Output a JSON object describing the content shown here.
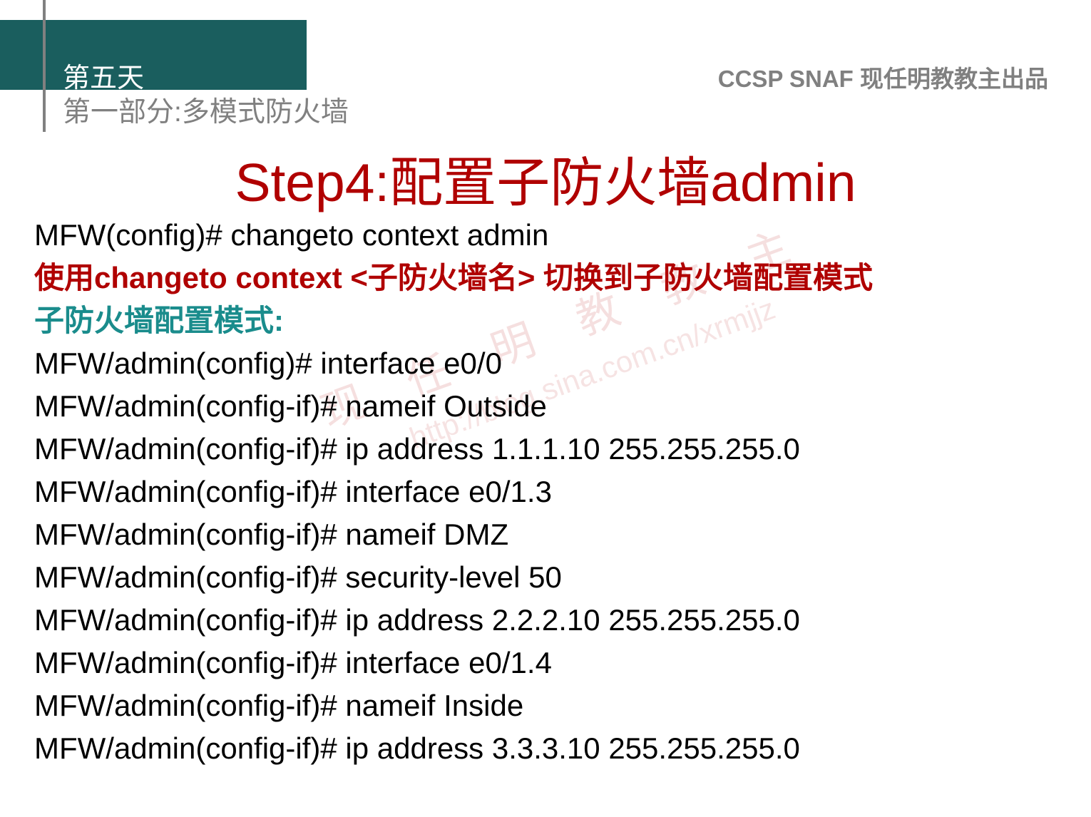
{
  "header": {
    "day": "第五天",
    "section": "第一部分:多模式防火墙",
    "source": "CCSP SNAF  现任明教教主出品"
  },
  "title": "Step4:配置子防火墙admin",
  "lines": [
    {
      "cls": "",
      "text": "MFW(config)# changeto context admin"
    },
    {
      "cls": "red",
      "text": "使用changeto context <子防火墙名> 切换到子防火墙配置模式"
    },
    {
      "cls": "teal",
      "text": "子防火墙配置模式:"
    },
    {
      "cls": "",
      "text": "MFW/admin(config)# interface e0/0"
    },
    {
      "cls": "",
      "text": "MFW/admin(config-if)# nameif Outside"
    },
    {
      "cls": "",
      "text": "MFW/admin(config-if)# ip address 1.1.1.10 255.255.255.0"
    },
    {
      "cls": "",
      "text": "MFW/admin(config-if)# interface e0/1.3"
    },
    {
      "cls": "",
      "text": "MFW/admin(config-if)# nameif DMZ"
    },
    {
      "cls": "",
      "text": "MFW/admin(config-if)# security-level 50"
    },
    {
      "cls": "",
      "text": "MFW/admin(config-if)# ip address 2.2.2.10 255.255.255.0"
    },
    {
      "cls": "",
      "text": "MFW/admin(config-if)# interface e0/1.4"
    },
    {
      "cls": "",
      "text": "MFW/admin(config-if)# nameif Inside"
    },
    {
      "cls": "",
      "text": "MFW/admin(config-if)# ip address 3.3.3.10 255.255.255.0"
    }
  ],
  "watermark": {
    "text1": "现 任 明 教 教 主",
    "text2": "http://blog.sina.com.cn/xrmjjz"
  }
}
